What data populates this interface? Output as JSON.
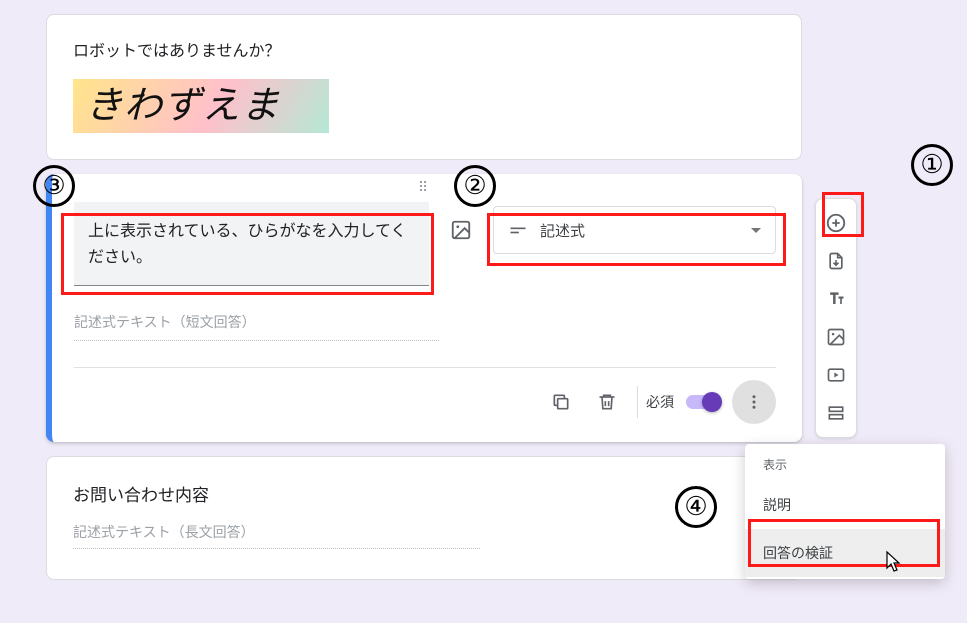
{
  "captcha": {
    "title": "ロボットではありませんか？",
    "image_text": "きわずえま"
  },
  "question": {
    "title": "上に表示されている、ひらがなを入力してください。",
    "type_label": "記述式",
    "answer_placeholder": "記述式テキスト（短文回答）",
    "required_label": "必須"
  },
  "paragraph": {
    "title": "お問い合わせ内容",
    "answer_placeholder": "記述式テキスト（長文回答）"
  },
  "dropdown": {
    "header": "表示",
    "item_description": "説明",
    "item_validation": "回答の検証"
  },
  "annotations": {
    "a1": "①",
    "a2": "②",
    "a3": "③",
    "a4": "④"
  }
}
